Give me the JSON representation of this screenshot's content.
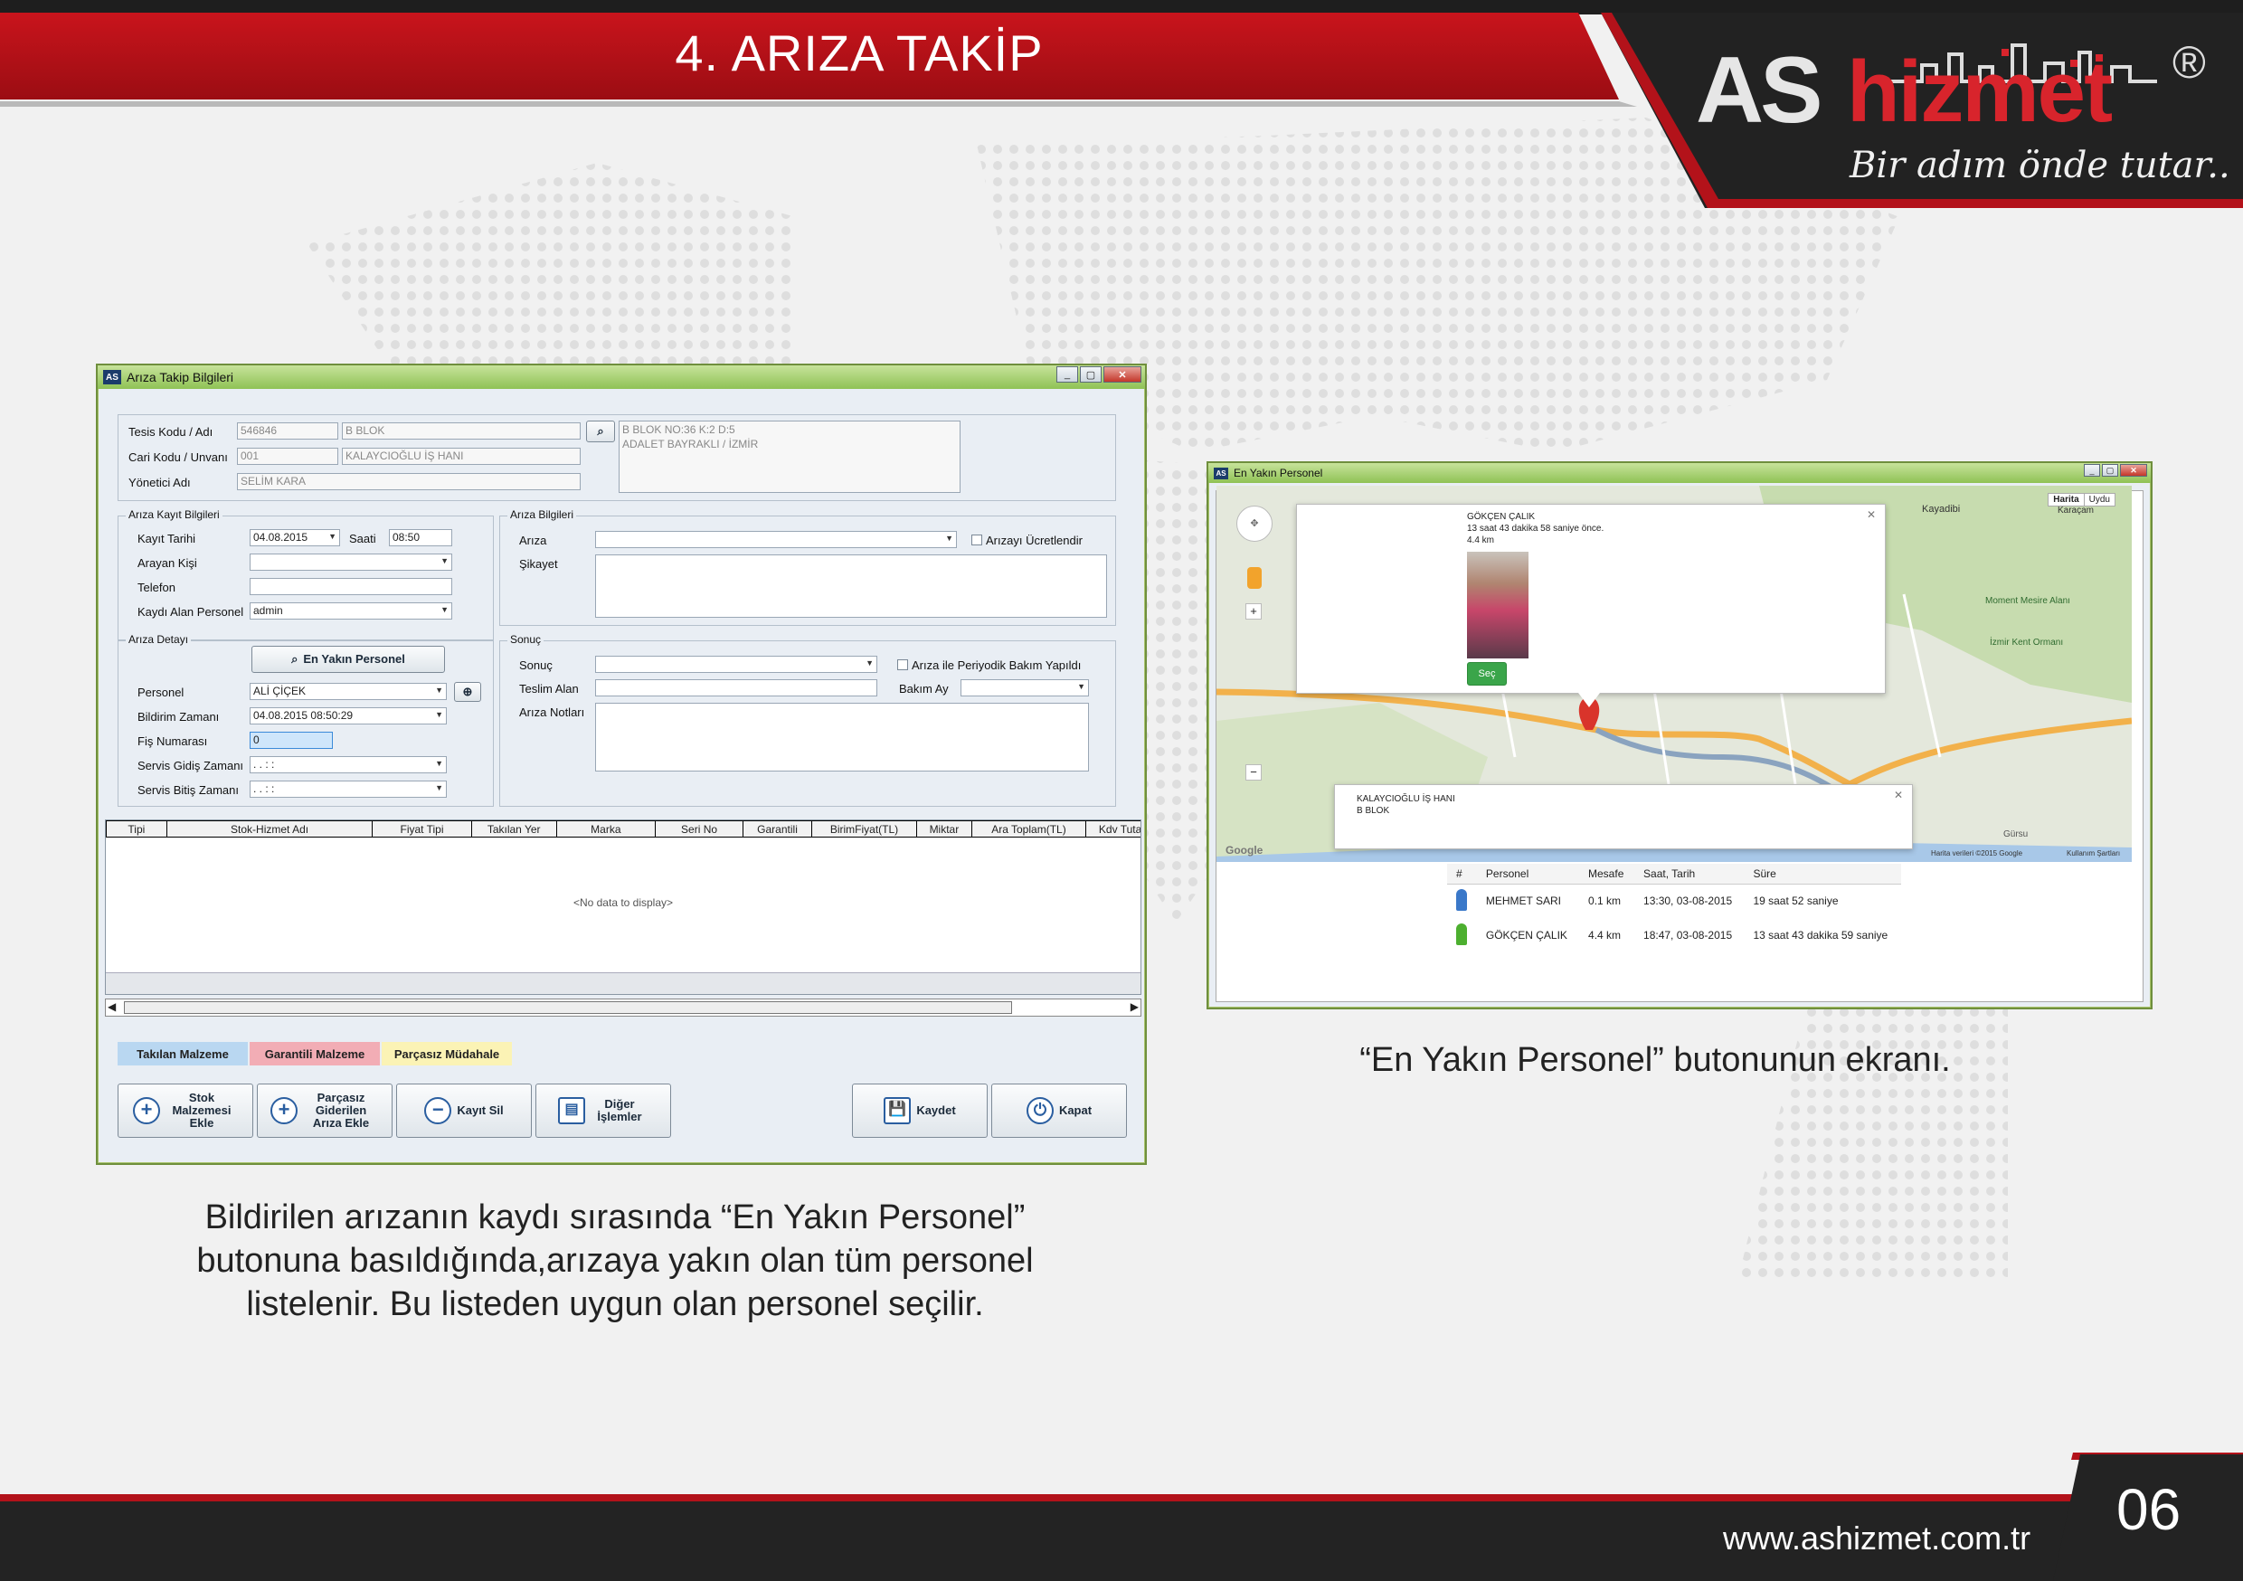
{
  "page": {
    "title": "4. ARIZA TAKİP",
    "logo_as": "AS",
    "logo_hizmet": "hizmet",
    "logo_reg": "®",
    "slogan": "Bir adım önde tutar..",
    "website": "www.ashizmet.com.tr",
    "page_number": "06",
    "caption_left": "Bildirilen arızanın kaydı sırasında “En Yakın Personel” butonuna basıldığında,arızaya yakın olan tüm personel listelenir. Bu listeden uygun olan personel seçilir.",
    "caption_right": "“En Yakın Personel” butonunun ekranı."
  },
  "form": {
    "window_title": "Arıza Takip Bilgileri",
    "app_icon": "AS",
    "tesis_label": "Tesis Kodu / Adı",
    "tesis_kodu": "546846",
    "tesis_adi": "B BLOK",
    "cari_label": "Cari Kodu / Unvanı",
    "cari_kodu": "001",
    "cari_unvan": "KALAYCIOĞLU İŞ HANI",
    "yonetici_label": "Yönetici Adı",
    "yonetici": "SELİM KARA",
    "address_line1": "B BLOK NO:36 K:2 D:5",
    "address_line2": "ADALET BAYRAKLI / İZMİR",
    "kayit_group": "Arıza Kayıt Bilgileri",
    "kayit_tarihi_label": "Kayıt Tarihi",
    "kayit_tarihi": "04.08.2015",
    "saati_label": "Saati",
    "saati": "08:50",
    "arayan_label": "Arayan Kişi",
    "telefon_label": "Telefon",
    "kaydi_alan_label": "Kaydı Alan Personel",
    "kaydi_alan": "admin",
    "ariza_bilgileri_group": "Arıza Bilgileri",
    "ariza_label": "Arıza",
    "ucretli_label": "Arızayı Ücretlendir",
    "sikayet_label": "Şikayet",
    "detay_group": "Arıza Detayı",
    "en_yakin_button": "En Yakın Personel",
    "personel_label": "Personel",
    "personel": "ALİ ÇİÇEK",
    "bildirim_label": "Bildirim Zamanı",
    "bildirim": "04.08.2015 08:50:29",
    "fis_label": "Fiş Numarası",
    "fis": "0",
    "gidis_label": "Servis Gidiş Zamanı",
    "gidis": ". .      : :",
    "bitis_label": "Servis Bitiş Zamanı",
    "bitis": ". .      : :",
    "sonuc_group": "Sonuç",
    "sonuc_label": "Sonuç",
    "periyodik_label": "Arıza ile Periyodik Bakım Yapıldı",
    "teslim_label": "Teslim Alan",
    "bakim_ay_label": "Bakım Ay",
    "notlar_label": "Arıza Notları",
    "columns": [
      "Tipi",
      "Stok-Hizmet Adı",
      "Fiyat Tipi",
      "Takılan Yer",
      "Marka",
      "Seri No",
      "Garantili",
      "BirimFiyat(TL)",
      "Miktar",
      "Ara Toplam(TL)",
      "Kdv Tuta"
    ],
    "no_data": "<No data to display>",
    "legend_takilan": "Takılan Malzeme",
    "legend_garantili": "Garantili Malzeme",
    "legend_parcasiz": "Parçasız Müdahale",
    "btn_stok": "Stok Malzemesi Ekle",
    "btn_parcasiz": "Parçasız Giderilen Arıza Ekle",
    "btn_kayit_sil": "Kayıt Sil",
    "btn_diger": "Diğer İşlemler",
    "btn_kaydet": "Kaydet",
    "btn_kapat": "Kapat"
  },
  "map_window": {
    "window_title": "En Yakın Personel",
    "map_label": "Harita",
    "satellite_label": "Uydu",
    "bubble1_name": "GÖKÇEN ÇALIK",
    "bubble1_time": "13 saat 43 dakika 58 saniye önce.",
    "bubble1_dist": "4.4 km",
    "sec_button": "Seç",
    "bubble2_line1": "KALAYCIOĞLU İŞ HANI",
    "bubble2_line2": "B BLOK",
    "places": [
      "Kayadibi",
      "Karaçam",
      "Moment Mesire Alanı",
      "İzmir Kent Ormanı",
      "Gürsu"
    ],
    "google": "Google",
    "copyright": "Harita verileri ©2015 Google",
    "terms": "Kullanım Şartları",
    "table_headers": [
      "#",
      "Personel",
      "Mesafe",
      "Saat, Tarih",
      "Süre"
    ],
    "rows": [
      {
        "name": "MEHMET SARI",
        "dist": "0.1 km",
        "time": "13:30, 03-08-2015",
        "dur": "19 saat 52 saniye",
        "color": "#3a78c9"
      },
      {
        "name": "GÖKÇEN ÇALIK",
        "dist": "4.4 km",
        "time": "18:47, 03-08-2015",
        "dur": "13 saat 43 dakika 59 saniye",
        "color": "#4caf2f"
      }
    ]
  }
}
